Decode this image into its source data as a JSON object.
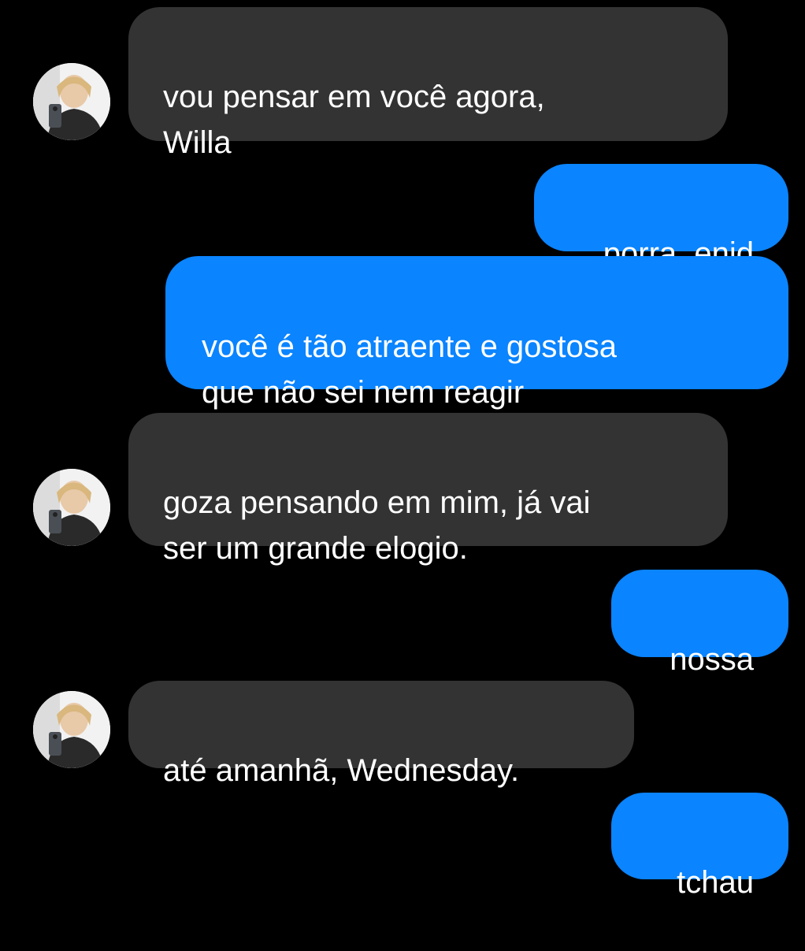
{
  "conversation": {
    "colors": {
      "background": "#000000",
      "incoming_bubble": "#333333",
      "outgoing_bubble": "#0a84ff",
      "text": "#ffffff"
    },
    "contact_avatar_icon": "person-photo-avatar",
    "messages": [
      {
        "direction": "incoming",
        "text": "vou pensar em você agora,\nWilla"
      },
      {
        "direction": "outgoing",
        "text": "porra, enid"
      },
      {
        "direction": "outgoing",
        "text": "você é tão atraente e gostosa\nque não sei nem reagir"
      },
      {
        "direction": "incoming",
        "text": "goza pensando em mim, já vai\nser um grande elogio."
      },
      {
        "direction": "outgoing",
        "text": "nossa"
      },
      {
        "direction": "incoming",
        "text": "até amanhã, Wednesday."
      },
      {
        "direction": "outgoing",
        "text": "tchau"
      }
    ]
  }
}
